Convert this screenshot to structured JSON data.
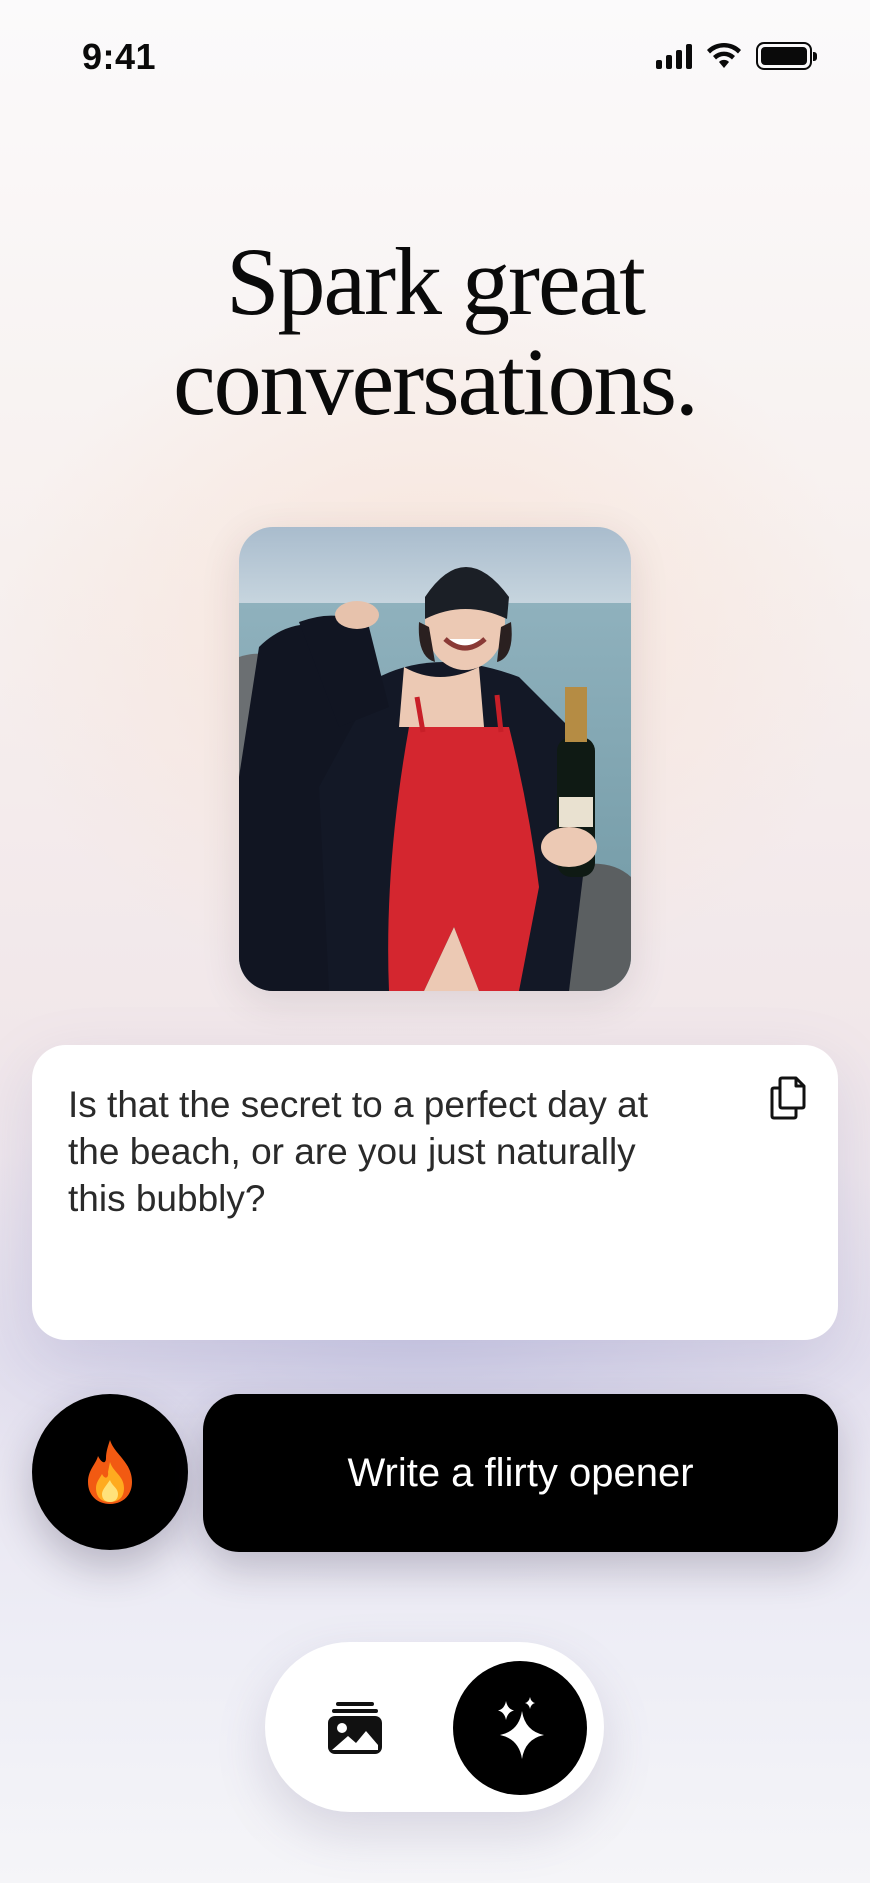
{
  "status_bar": {
    "time": "9:41",
    "icons": [
      "cellular-signal-icon",
      "wifi-icon",
      "battery-icon"
    ]
  },
  "headline": {
    "line1": "Spark great",
    "line2": "conversations."
  },
  "photo": {
    "icon": "photo-of-woman-with-champagne"
  },
  "message_card": {
    "text": "Is that the secret to a perfect day at the beach, or are you just naturally this bubbly?",
    "copy_icon": "copy-icon"
  },
  "actions": {
    "tone_icon": "fire-icon",
    "cta_label": "Write a flirty opener"
  },
  "bottom_nav": {
    "items": [
      {
        "icon": "gallery-icon",
        "active": false
      },
      {
        "icon": "sparkles-icon",
        "active": true
      }
    ]
  },
  "colors": {
    "primary": "#000000",
    "card": "#ffffff",
    "text": "#2a2a2a"
  }
}
